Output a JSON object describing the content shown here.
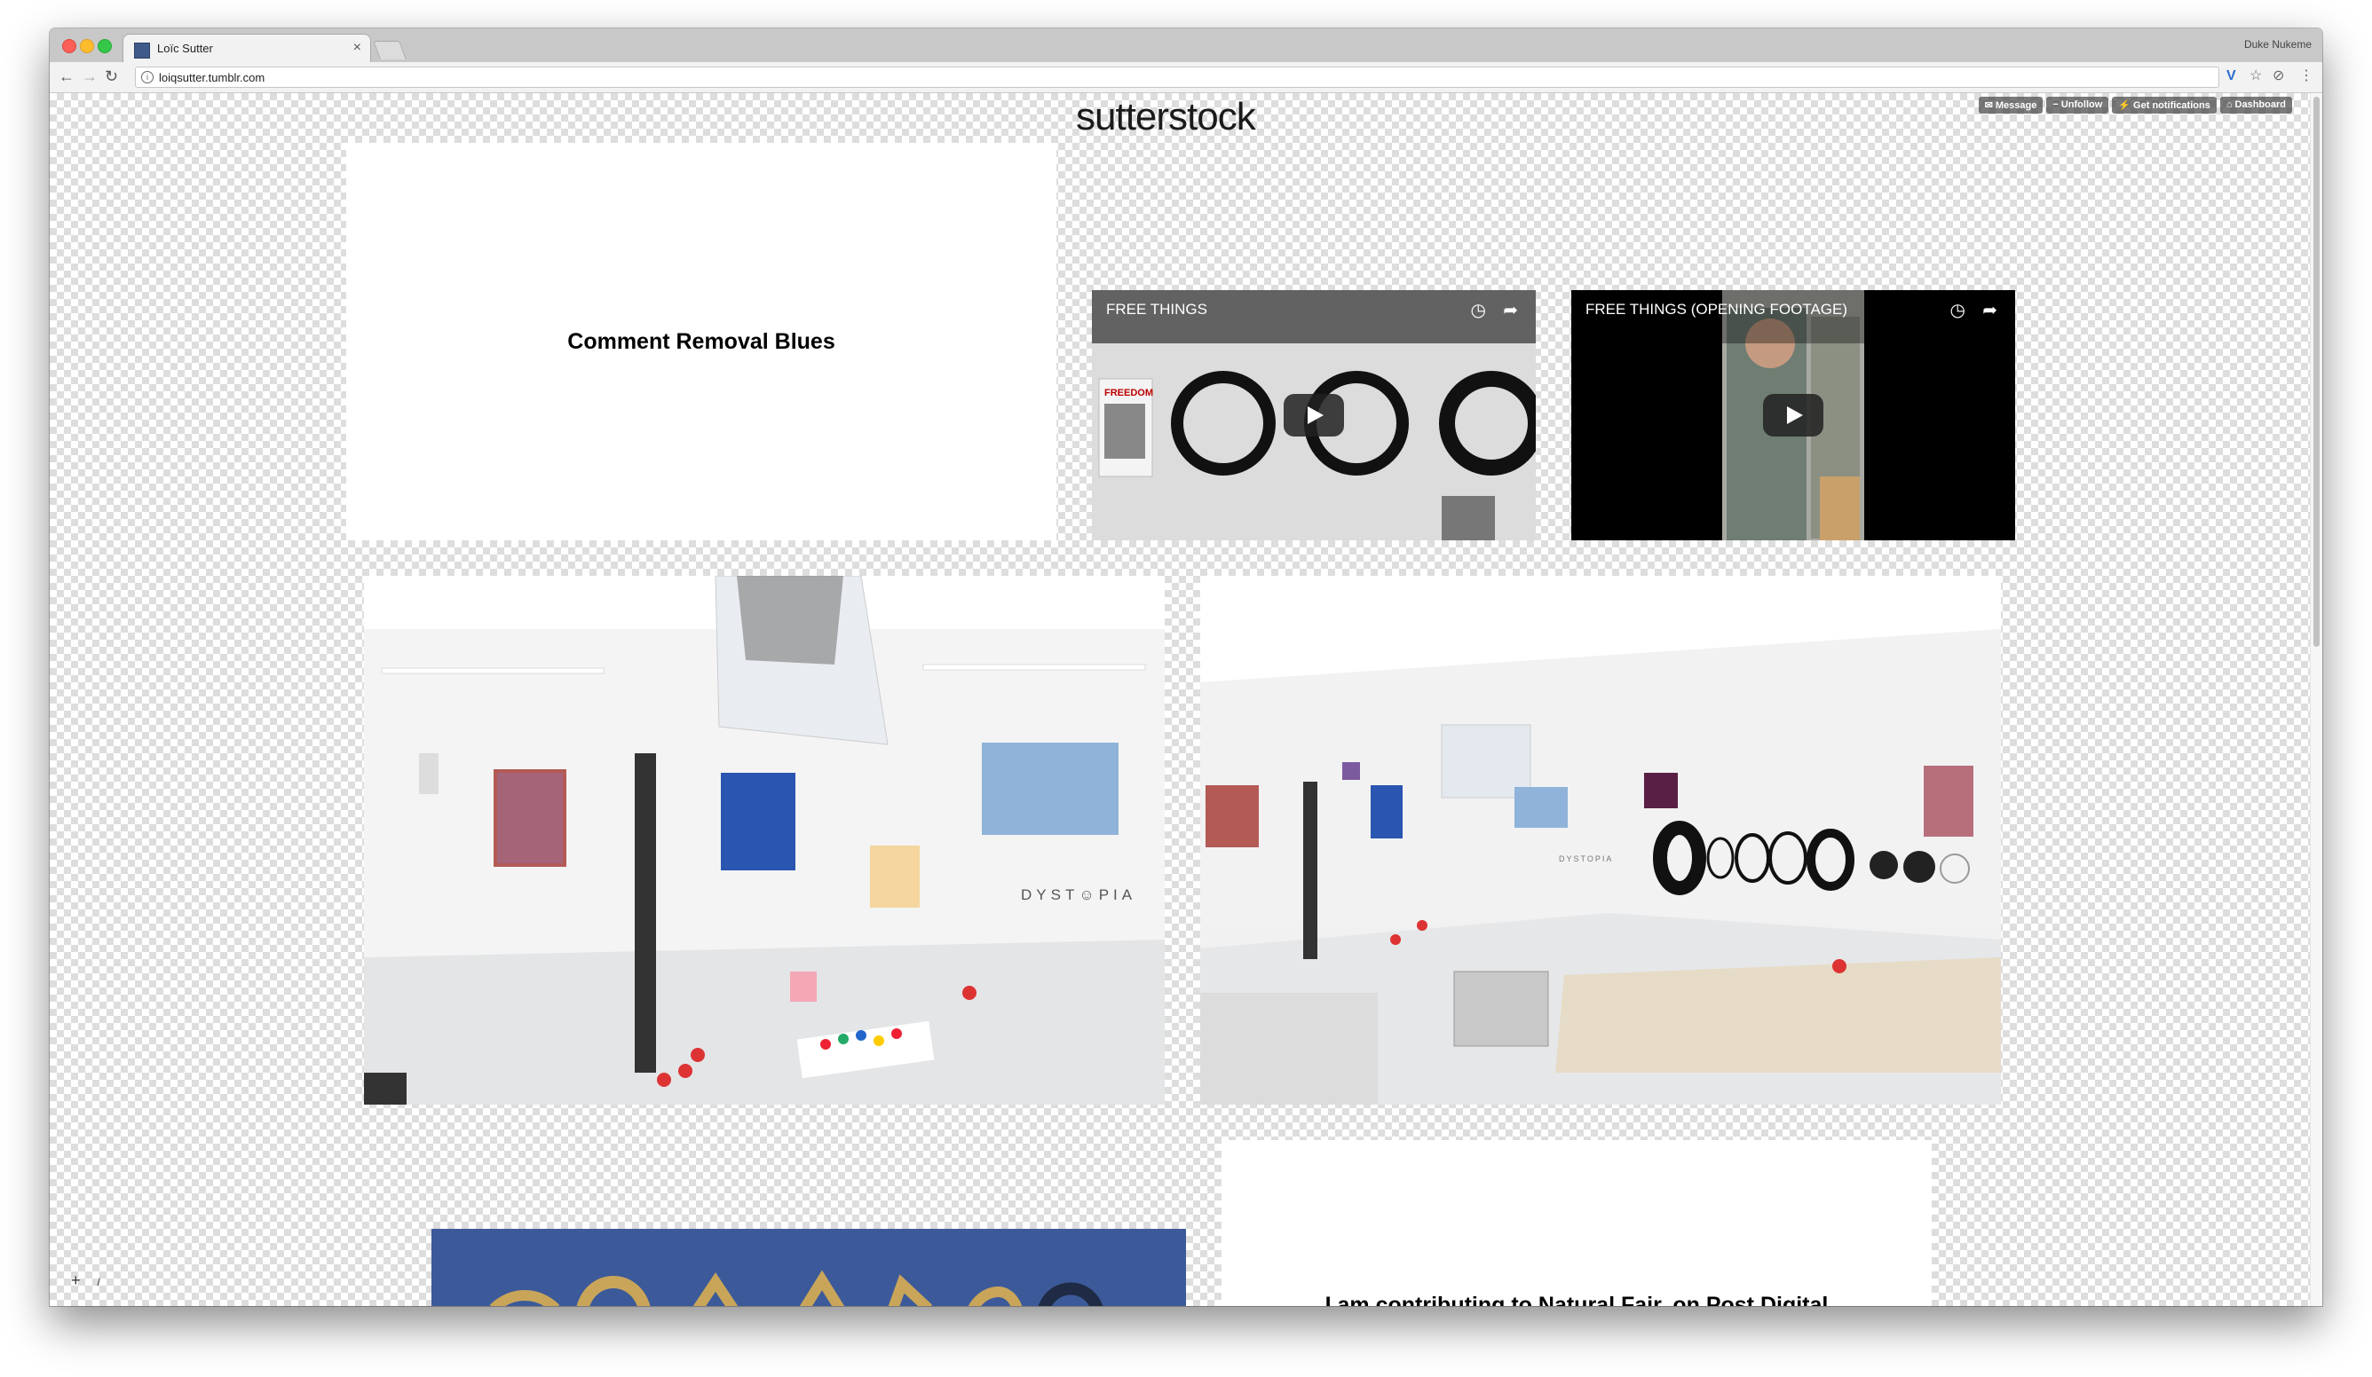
{
  "browser": {
    "tab_title": "Loïc Sutter",
    "tab_close": "×",
    "profile_name": "Duke Nukeme",
    "url": "loiqsutter.tumblr.com",
    "back_icon": "←",
    "forward_icon": "→",
    "reload_icon": "↻",
    "info_icon": "i",
    "vivaldi_icon": "V",
    "star_icon": "☆",
    "ext_icon": "⊘",
    "menu_icon": "⋮"
  },
  "tumblr_controls": [
    {
      "label": "Message"
    },
    {
      "label": "Unfollow"
    },
    {
      "label": "Get notifications"
    },
    {
      "label": "Dashboard"
    }
  ],
  "blog": {
    "logo": "sutterstock"
  },
  "posts": {
    "text_post_1": "Comment Removal Blues",
    "video_1_title": "FREE THINGS",
    "video_2_title": "FREE THINGS (OPENING FOOTAGE)",
    "video_1_poster_text": "FREEDOM",
    "photo_1_wall_text": "DYST☺PIA",
    "photo_2_wall_text": "DYSTOPIA",
    "text_post_2": "I am contributing to Natural Fair, on Post Digital"
  },
  "page_tools": {
    "plus": "+",
    "slash": "/"
  }
}
